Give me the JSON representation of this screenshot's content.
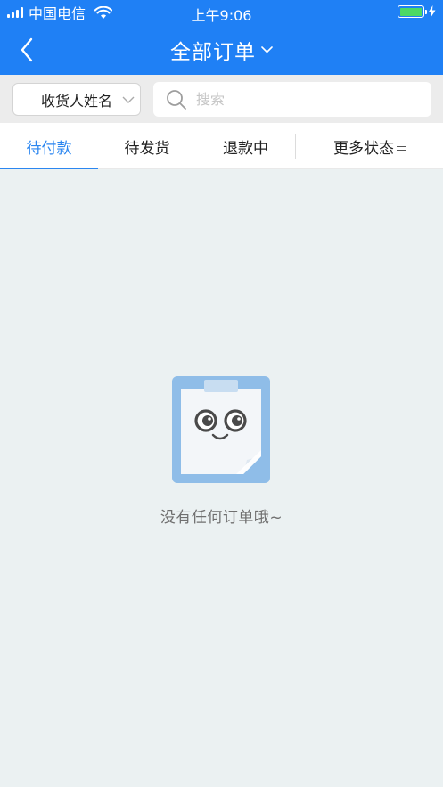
{
  "status_bar": {
    "carrier": "中国电信",
    "time": "上午9:06",
    "battery_percent": 100,
    "signal_bars": 4
  },
  "nav": {
    "title": "全部订单",
    "back_icon": "chevron-left-icon",
    "title_dropdown_icon": "chevron-down-icon"
  },
  "filter": {
    "name_select_label": "收货人姓名",
    "search_placeholder": "搜索",
    "search_value": ""
  },
  "tabs": [
    {
      "label": "待付款",
      "active": true
    },
    {
      "label": "待发货",
      "active": false
    },
    {
      "label": "退款中",
      "active": false
    },
    {
      "label": "更多状态",
      "active": false
    }
  ],
  "empty_state": {
    "message": "没有任何订单哦~",
    "illustration": "empty-clipboard-illustration"
  },
  "colors": {
    "header_blue": "#1f80f5",
    "active_tab": "#2b86f0",
    "page_background": "#ebf1f2",
    "battery_green": "#4cd964"
  }
}
